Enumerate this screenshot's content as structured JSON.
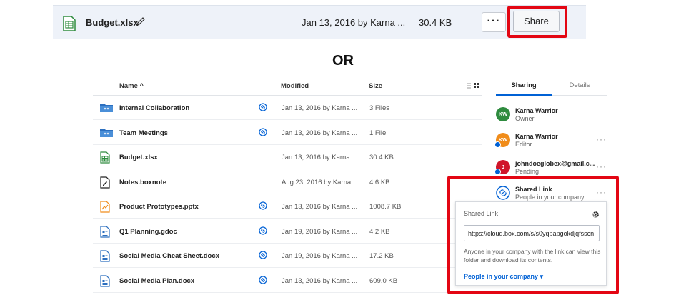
{
  "colors": {
    "highlight": "#e30613",
    "accent": "#0061d5"
  },
  "topbar": {
    "icon": "spreadsheet-icon",
    "filename": "Budget.xlsx",
    "modified": "Jan 13, 2016 by Karna ...",
    "size": "30.4 KB",
    "more_label": "···",
    "share_label": "Share"
  },
  "divider_text": "OR",
  "list": {
    "header": {
      "name": "Name ^",
      "modified": "Modified",
      "size": "Size"
    },
    "rows": [
      {
        "name": "Internal Collaboration",
        "icon": "shared-folder-icon",
        "collab": true,
        "modified": "Jan 13, 2016 by Karna ...",
        "size": "3 Files"
      },
      {
        "name": "Team Meetings",
        "icon": "shared-folder-icon",
        "collab": true,
        "modified": "Jan 13, 2016 by Karna ...",
        "size": "1 File"
      },
      {
        "name": "Budget.xlsx",
        "icon": "spreadsheet-icon",
        "collab": false,
        "modified": "Jan 13, 2016 by Karna ...",
        "size": "30.4 KB"
      },
      {
        "name": "Notes.boxnote",
        "icon": "boxnote-icon",
        "collab": false,
        "modified": "Aug 23, 2016 by Karna ...",
        "size": "4.6 KB"
      },
      {
        "name": "Product Prototypes.pptx",
        "icon": "presentation-icon",
        "collab": true,
        "modified": "Jan 13, 2016 by Karna ...",
        "size": "1008.7 KB"
      },
      {
        "name": "Q1 Planning.gdoc",
        "icon": "document-icon",
        "collab": true,
        "modified": "Jan 19, 2016 by Karna ...",
        "size": "4.2 KB"
      },
      {
        "name": "Social Media Cheat Sheet.docx",
        "icon": "document-icon",
        "collab": true,
        "modified": "Jan 19, 2016 by Karna ...",
        "size": "17.2 KB"
      },
      {
        "name": "Social Media Plan.docx",
        "icon": "document-icon",
        "collab": true,
        "modified": "Jan 13, 2016 by Karna ...",
        "size": "609.0 KB"
      }
    ]
  },
  "sharing": {
    "tabs": [
      {
        "label": "Sharing"
      },
      {
        "label": "Details"
      }
    ],
    "people": [
      {
        "initials": "KW",
        "name": "Karna Warrior",
        "role": "Owner",
        "color": "#2e8b3e"
      },
      {
        "initials": "KW",
        "name": "Karna Warrior",
        "role": "Editor",
        "color": "#f08c1a"
      },
      {
        "initials": "J",
        "name": "johndoeglobex@gmail.c...",
        "role": "Pending",
        "color": "#d0152a"
      },
      {
        "name": "Shared Link",
        "role": "People in your company"
      }
    ],
    "more_label": "···"
  },
  "shared_link": {
    "title": "Shared Link",
    "url": "https://cloud.box.com/s/s0yqpapgokdjqfsscn",
    "description": "Anyone in your company with the link can view this folder and download its contents.",
    "access_label": "People in your company ▾"
  }
}
